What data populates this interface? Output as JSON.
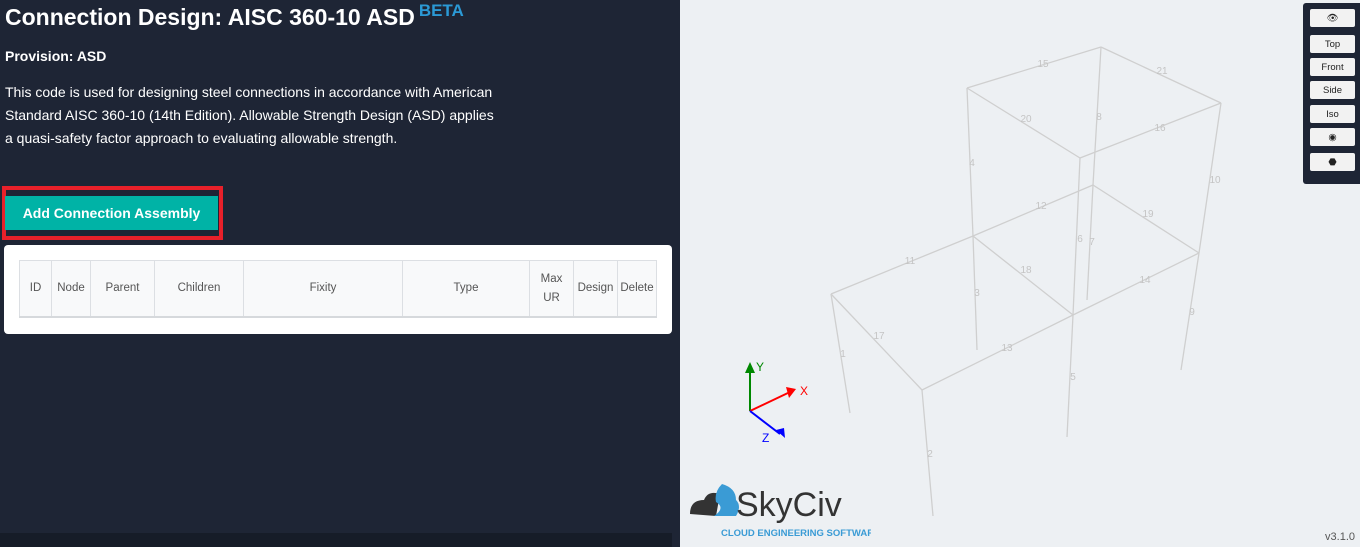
{
  "header": {
    "title": "Connection Design: AISC 360-10 ASD",
    "badge": "BETA"
  },
  "provision": "Provision: ASD",
  "description": "This code is used for designing steel connections in accordance with American Standard AISC 360-10 (14th Edition). Allowable Strength Design (ASD) applies a quasi-safety factor approach to evaluating allowable strength.",
  "add_button": "Add Connection Assembly",
  "table": {
    "columns": [
      "ID",
      "Node",
      "Parent",
      "Children",
      "Fixity",
      "Type",
      "Max UR",
      "Design",
      "Delete"
    ]
  },
  "toolbar": {
    "view_icon": "eye-icon",
    "top": "Top",
    "front": "Front",
    "side": "Side",
    "iso": "Iso",
    "screenshot_icon": "camera-icon",
    "cube_icon": "cube-icon"
  },
  "axes": {
    "x": "X",
    "y": "Y",
    "z": "Z",
    "colors": {
      "x": "#ff0000",
      "y": "#008800",
      "z": "#0000ff"
    }
  },
  "members": [
    "1",
    "2",
    "3",
    "4",
    "5",
    "6",
    "7",
    "8",
    "9",
    "10",
    "11",
    "12",
    "13",
    "14",
    "15",
    "16",
    "17",
    "18",
    "19",
    "20",
    "21"
  ],
  "logo": {
    "name": "SkyCiv",
    "tagline": "CLOUD ENGINEERING SOFTWARE"
  },
  "version": "v3.1.0",
  "colors": {
    "accent": "#00b3a6",
    "highlight": "#e8202a",
    "panel": "#1e2535",
    "beta": "#2b9ad6"
  }
}
